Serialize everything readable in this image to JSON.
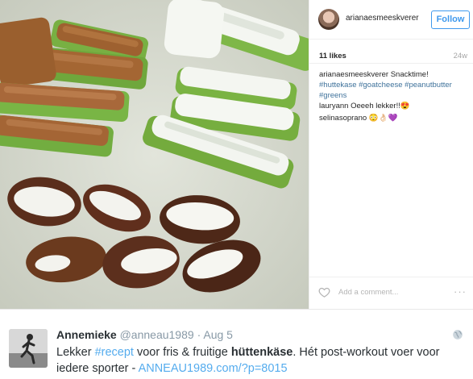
{
  "instagram": {
    "photo_alt": "",
    "username": "arianaesmeeskverer",
    "follow_label": "Follow",
    "likes": "11 likes",
    "time": "24w",
    "caption": {
      "user": "arianaesmeeskverer",
      "text": "Snacktime!",
      "hashtags_line1": "#huttekase #goatcheese #peanutbutter",
      "hashtags_line2": "#greens"
    },
    "comments": [
      {
        "user": "lauryann",
        "text": "Oeeeh lekker!!😍"
      },
      {
        "user": "selinasoprano",
        "text": "😳👌🏻💜"
      }
    ],
    "add_comment_placeholder": "Add a comment...",
    "more_label": "···"
  },
  "tweet": {
    "name": "Annemieke",
    "handle": "@anneau1989",
    "separator": "·",
    "date": "Aug 5",
    "text_part1": "Lekker ",
    "hashtag": "#recept",
    "text_part2": " voor fris & fruitige ",
    "bold_word": "hüttenkäse",
    "text_part3": ". Hét post-workout voer voor iedere sporter - ",
    "link": "ANNEAU1989.com/?p=8015"
  },
  "colors": {
    "instagram_blue": "#3f99ed",
    "hashtag_blue": "#3f729b",
    "twitter_link": "#55acee",
    "peanut_butter": "#a86a3a",
    "celery": "#7cb342",
    "date_fruit": "#5a2e1c"
  }
}
